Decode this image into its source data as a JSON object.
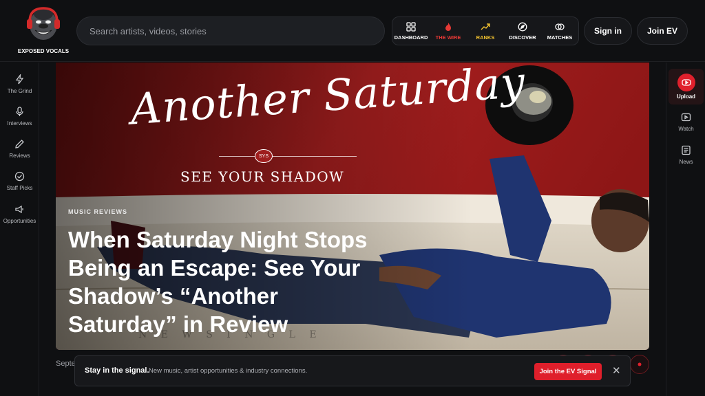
{
  "header": {
    "logo_text": "EXPOSED VOCALS",
    "search_placeholder": "Search artists, videos, stories",
    "nav": [
      {
        "label": "DASHBOARD",
        "icon": "grid-icon",
        "color": "#ffffff"
      },
      {
        "label": "THE WIRE",
        "icon": "flame-icon",
        "color": "#e53935"
      },
      {
        "label": "RANKS",
        "icon": "trend-icon",
        "color": "#f2c230"
      },
      {
        "label": "DISCOVER",
        "icon": "compass-icon",
        "color": "#ffffff"
      },
      {
        "label": "MATCHES",
        "icon": "rings-icon",
        "color": "#ffffff"
      }
    ],
    "sign_in": "Sign in",
    "join": "Join EV"
  },
  "left_sidebar": [
    {
      "label": "The Grind",
      "icon": "bolt-icon"
    },
    {
      "label": "Interviews",
      "icon": "mic-icon"
    },
    {
      "label": "Reviews",
      "icon": "pencil-icon"
    },
    {
      "label": "Staff Picks",
      "icon": "check-circle-icon"
    },
    {
      "label": "Opportunities",
      "icon": "megaphone-icon"
    }
  ],
  "right_sidebar": [
    {
      "label": "Upload",
      "icon": "play-circle-icon"
    },
    {
      "label": "Watch",
      "icon": "video-icon"
    },
    {
      "label": "News",
      "icon": "news-icon"
    }
  ],
  "hero": {
    "art_title": "Another Saturday",
    "art_badge": "SYS",
    "art_subtitle": "SEE YOUR SHADOW",
    "kicker": "MUSIC REVIEWS",
    "headline": "When Saturday Night Stops Being an Escape: See Your Shadow’s “Another Saturday” in Review",
    "faint_text": "N E W   S I N G L E"
  },
  "date_partial": "Septe",
  "signal_bar": {
    "title": "Stay in the signal.",
    "description": "New music, artist opportunities & industry connections.",
    "cta": "Join the EV Signal",
    "close": "✕"
  },
  "colors": {
    "accent": "#df1f2b",
    "background": "#0f1012",
    "hero_red": "#a01e1e"
  }
}
